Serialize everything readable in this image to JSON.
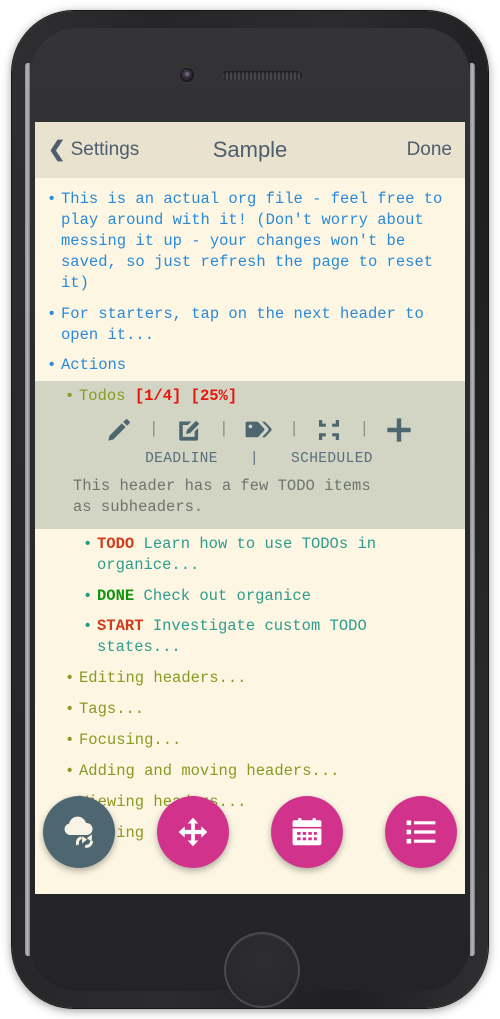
{
  "device": {
    "camera_icon": "front-camera",
    "speaker_icon": "earpiece-speaker",
    "home_button_icon": "home-button"
  },
  "navbar": {
    "back_icon": "chevron-left-icon",
    "back_label": "Settings",
    "title": "Sample",
    "done_label": "Done"
  },
  "colors": {
    "screen_bg": "#fdf6e3",
    "navbar_bg": "#e9e2cf",
    "selected_bg": "#d2d5c3",
    "level1": "#2b8ad8",
    "level2": "#8a9a23",
    "level3": "#2e9c8e",
    "cookie_red": "#e8130b",
    "todo_keyword": "#d13b1a",
    "done_keyword": "#12930f",
    "fab_pink": "#d1328c",
    "fab_sync": "#4d6670",
    "toolbar_icon": "#4d6670",
    "date_label": "#5b6d7c",
    "body_text": "#6f756e"
  },
  "entries": [
    {
      "id": "intro",
      "level": 1,
      "bullet": "•",
      "text": "This is an actual org file - feel free to play around with it! (Don't worry about messing it up - your changes won't be saved, so just refresh the page to reset it)"
    },
    {
      "id": "for-starters",
      "level": 1,
      "bullet": "•",
      "text": "For starters, tap on the next header to open it..."
    },
    {
      "id": "actions",
      "level": 1,
      "bullet": "•",
      "text": "Actions"
    }
  ],
  "selected_header": {
    "id": "todos",
    "level": 2,
    "bullet": "•",
    "title": "Todos",
    "cookie_count": "[1/4]",
    "cookie_percent": "[25%]",
    "body": "This header has a few TODO items\nas subheaders.",
    "toolbar": [
      {
        "name": "edit-title-icon",
        "icon": "pencil"
      },
      {
        "separator": "|"
      },
      {
        "name": "edit-description-icon",
        "icon": "note-edit"
      },
      {
        "separator": "|"
      },
      {
        "name": "tags-icon",
        "icon": "tag"
      },
      {
        "separator": "|"
      },
      {
        "name": "narrow-icon",
        "icon": "compress"
      },
      {
        "separator": "|"
      },
      {
        "name": "add-header-icon",
        "icon": "plus"
      }
    ],
    "date_row": {
      "deadline_label": "DEADLINE",
      "separator": "|",
      "scheduled_label": "SCHEDULED"
    }
  },
  "todo_items": [
    {
      "keyword": "TODO",
      "keyword_class": "kw-todo",
      "text": "Learn how to use TODOs in organice..."
    },
    {
      "keyword": "DONE",
      "keyword_class": "kw-done",
      "text": "Check out organice"
    },
    {
      "keyword": "START",
      "keyword_class": "kw-start",
      "text": "Investigate custom TODO states..."
    }
  ],
  "trailing_entries": [
    {
      "id": "editing-headers",
      "level": 2,
      "bullet": "•",
      "text": "Editing headers..."
    },
    {
      "id": "tags",
      "level": 2,
      "bullet": "•",
      "text": "Tags..."
    },
    {
      "id": "focusing",
      "level": 2,
      "bullet": "•",
      "text": "Focusing..."
    },
    {
      "id": "adding-moving",
      "level": 2,
      "bullet": "•",
      "text": "Adding and moving headers..."
    },
    {
      "id": "viewing-headers",
      "level": 2,
      "bullet": "•",
      "text": "Viewing headers..."
    },
    {
      "id": "syncing",
      "level": 2,
      "bullet": "•",
      "text": "Syncing"
    }
  ],
  "fabs": [
    {
      "name": "sync-fab",
      "icon": "cloud-sync",
      "style": "sync"
    },
    {
      "name": "move-fab",
      "icon": "arrows-move",
      "style": "pink"
    },
    {
      "name": "calendar-fab",
      "icon": "calendar",
      "style": "pink"
    },
    {
      "name": "list-fab",
      "icon": "list-view",
      "style": "pink"
    }
  ]
}
